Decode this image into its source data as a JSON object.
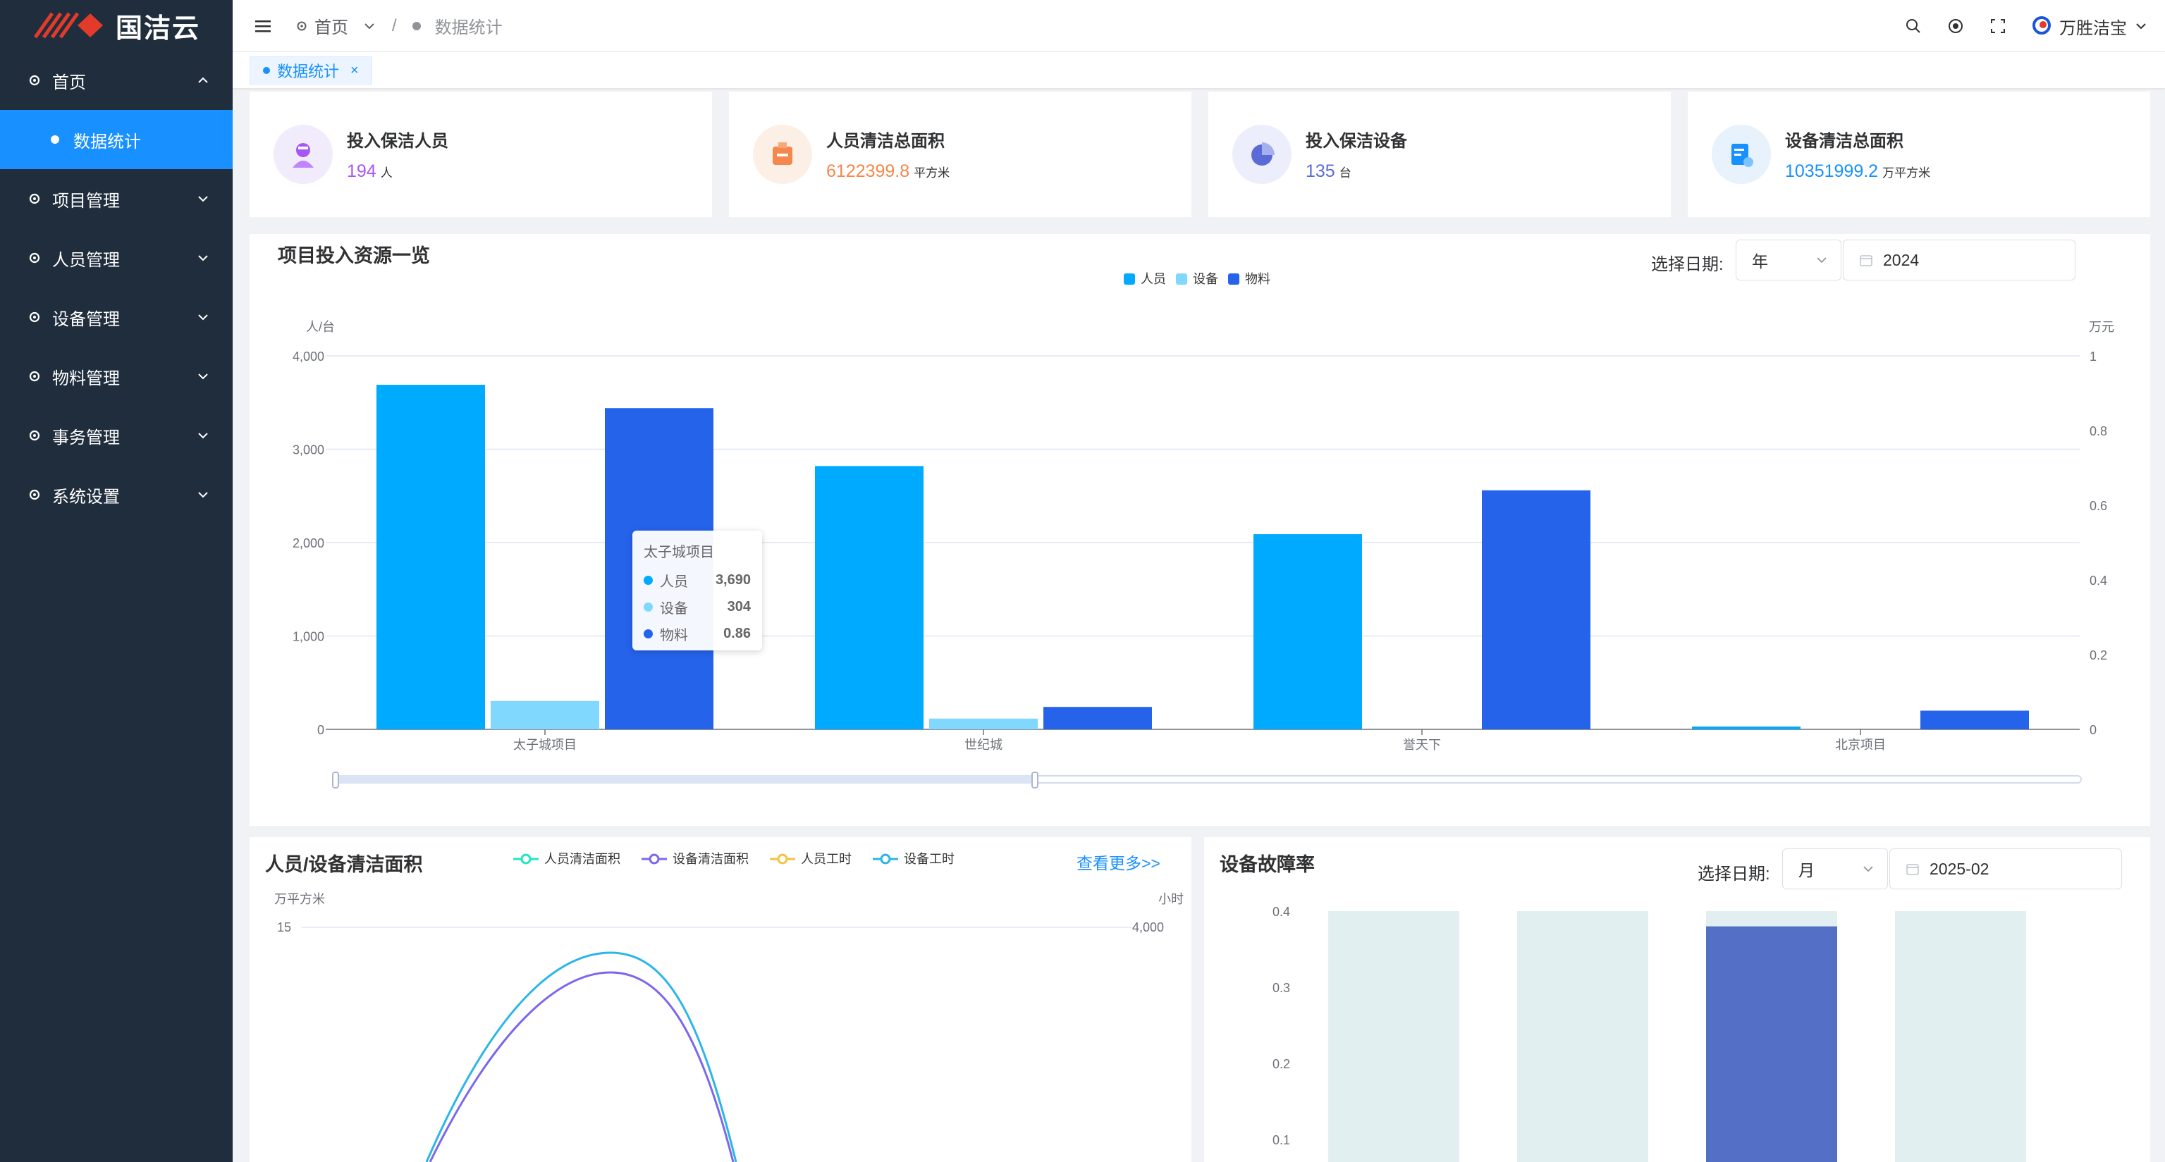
{
  "app": {
    "name": "国洁云"
  },
  "sidebar": {
    "items": [
      {
        "label": "首页",
        "expanded": true,
        "children": [
          {
            "label": "数据统计",
            "active": true
          }
        ]
      },
      {
        "label": "项目管理"
      },
      {
        "label": "人员管理"
      },
      {
        "label": "设备管理"
      },
      {
        "label": "物料管理"
      },
      {
        "label": "事务管理"
      },
      {
        "label": "系统设置"
      }
    ]
  },
  "header": {
    "breadcrumb": {
      "home": "首页",
      "current": "数据统计"
    },
    "user": {
      "name": "万胜洁宝"
    }
  },
  "tags": [
    {
      "label": "数据统计",
      "close": "×"
    }
  ],
  "stats": [
    {
      "title": "投入保洁人员",
      "value": "194",
      "unit": "人",
      "color": "#a855f7",
      "icon": "cleaner-icon"
    },
    {
      "title": "人员清洁总面积",
      "value": "6122399.8",
      "unit": "平方米",
      "color": "#f4874b",
      "icon": "building-icon"
    },
    {
      "title": "投入保洁设备",
      "value": "135",
      "unit": "台",
      "color": "#5b6bd6",
      "icon": "pie-icon"
    },
    {
      "title": "设备清洁总面积",
      "value": "10351999.2",
      "unit": "万平方米",
      "color": "#1890ff",
      "icon": "document-icon"
    }
  ],
  "resource_panel": {
    "title": "项目投入资源一览",
    "date_label": "选择日期:",
    "period": "年",
    "date": "2024"
  },
  "area_panel": {
    "title": "人员/设备清洁面积",
    "more": "查看更多>>"
  },
  "fault_panel": {
    "title": "设备故障率",
    "date_label": "选择日期:",
    "period": "月",
    "date": "2025-02"
  },
  "tooltip": {
    "title": "太子城项目",
    "rows": [
      {
        "name": "人员",
        "value": "3,690",
        "color": "#00aaff"
      },
      {
        "name": "设备",
        "value": "304",
        "color": "#80d8ff"
      },
      {
        "name": "物料",
        "value": "0.86",
        "color": "#2563eb"
      }
    ]
  },
  "chart_data": [
    {
      "type": "bar",
      "categories": [
        "太子城项目",
        "世纪城",
        "誉天下",
        "北京项目"
      ],
      "series": [
        {
          "name": "人员",
          "axis": "left",
          "values": [
            3690,
            2820,
            2090,
            30
          ],
          "color": "#00aaff"
        },
        {
          "name": "设备",
          "axis": "left",
          "values": [
            304,
            115,
            0,
            0
          ],
          "color": "#80d8ff"
        },
        {
          "name": "物料",
          "axis": "right",
          "values": [
            0.86,
            0.06,
            0.64,
            0.05
          ],
          "color": "#2563eb"
        }
      ],
      "ylabel_left": "人/台",
      "ylabel_right": "万元",
      "ylim_left": [
        0,
        4000
      ],
      "ylim_right": [
        0,
        1
      ],
      "yticks_left": [
        "0",
        "1,000",
        "2,000",
        "3,000",
        "4,000"
      ],
      "yticks_right": [
        "0",
        "0.2",
        "0.4",
        "0.6",
        "0.8",
        "1"
      ],
      "legend_position": "top-center",
      "grid": true
    },
    {
      "type": "line",
      "legend": [
        {
          "name": "人员清洁面积",
          "color": "#21e6c1"
        },
        {
          "name": "设备清洁面积",
          "color": "#7b68ee"
        },
        {
          "name": "人员工时",
          "color": "#f5c242"
        },
        {
          "name": "设备工时",
          "color": "#2bb5e8"
        }
      ],
      "ylabel_left": "万平方米",
      "ylabel_right": "小时",
      "ytick_left_top": "15",
      "ytick_right_top": "4,000",
      "grid": true
    },
    {
      "type": "bar",
      "yticks": [
        "0.1",
        "0.2",
        "0.3",
        "0.4"
      ],
      "ylim": [
        0,
        0.4
      ],
      "values": [
        0,
        0,
        0.38,
        0
      ],
      "background_color": "#e2eff0",
      "bar_color": "#5470c6"
    }
  ]
}
